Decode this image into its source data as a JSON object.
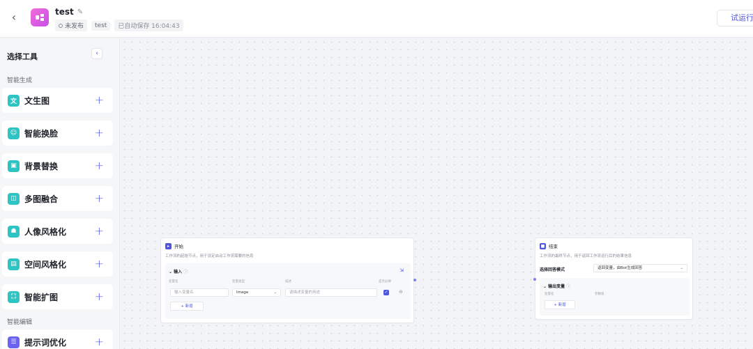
{
  "header": {
    "back_icon": "chevron-left-icon",
    "title": "test",
    "status": "未发布",
    "tag": "test",
    "autosave": "已自动保存 16:04:43",
    "trial_button": "试运行",
    "accent_color": "#4e55e0"
  },
  "sidebar": {
    "title": "选择工具",
    "groups": [
      {
        "label": "智能生成",
        "items": [
          {
            "label": "文生图",
            "icon": "text-to-image-icon",
            "icon_text": "文",
            "color": "#2ec4c4"
          },
          {
            "label": "智能换脸",
            "icon": "face-swap-icon",
            "icon_text": "☺",
            "color": "#2ec4c4"
          },
          {
            "label": "背景替换",
            "icon": "background-replace-icon",
            "icon_text": "▣",
            "color": "#2ec4c4"
          },
          {
            "label": "多图融合",
            "icon": "multi-image-fusion-icon",
            "icon_text": "◫",
            "color": "#2ec4c4"
          },
          {
            "label": "人像风格化",
            "icon": "portrait-style-icon",
            "icon_text": "☗",
            "color": "#2ec4c4"
          },
          {
            "label": "空间风格化",
            "icon": "space-style-icon",
            "icon_text": "▤",
            "color": "#2ec4c4"
          },
          {
            "label": "智能扩图",
            "icon": "image-expand-icon",
            "icon_text": "⛶",
            "color": "#2ec4c4"
          }
        ]
      },
      {
        "label": "智能编辑",
        "items": [
          {
            "label": "提示词优化",
            "icon": "prompt-optimize-icon",
            "icon_text": "☰",
            "color": "#6b63f0"
          }
        ]
      }
    ]
  },
  "start_node": {
    "title": "开始",
    "description": "工作流的起始节点，用于设定启动工作流需要的信息",
    "section_title": "输入",
    "columns": [
      "变量名",
      "变量类型",
      "描述",
      "是否必要"
    ],
    "var_name_placeholder": "输入变量名",
    "var_type": "Image",
    "desc_placeholder": "请描述变量的用途",
    "add_button": "+ 新增"
  },
  "end_node": {
    "title": "结束",
    "description": "工作流的最终节点，用于返回工作流运行后的结果信息",
    "mode_label": "选择回答模式",
    "mode_value": "返回变量，由Bot生成回答",
    "section_title": "输出变量",
    "columns": [
      "变量名",
      "参数值"
    ],
    "add_button": "+ 新增"
  }
}
